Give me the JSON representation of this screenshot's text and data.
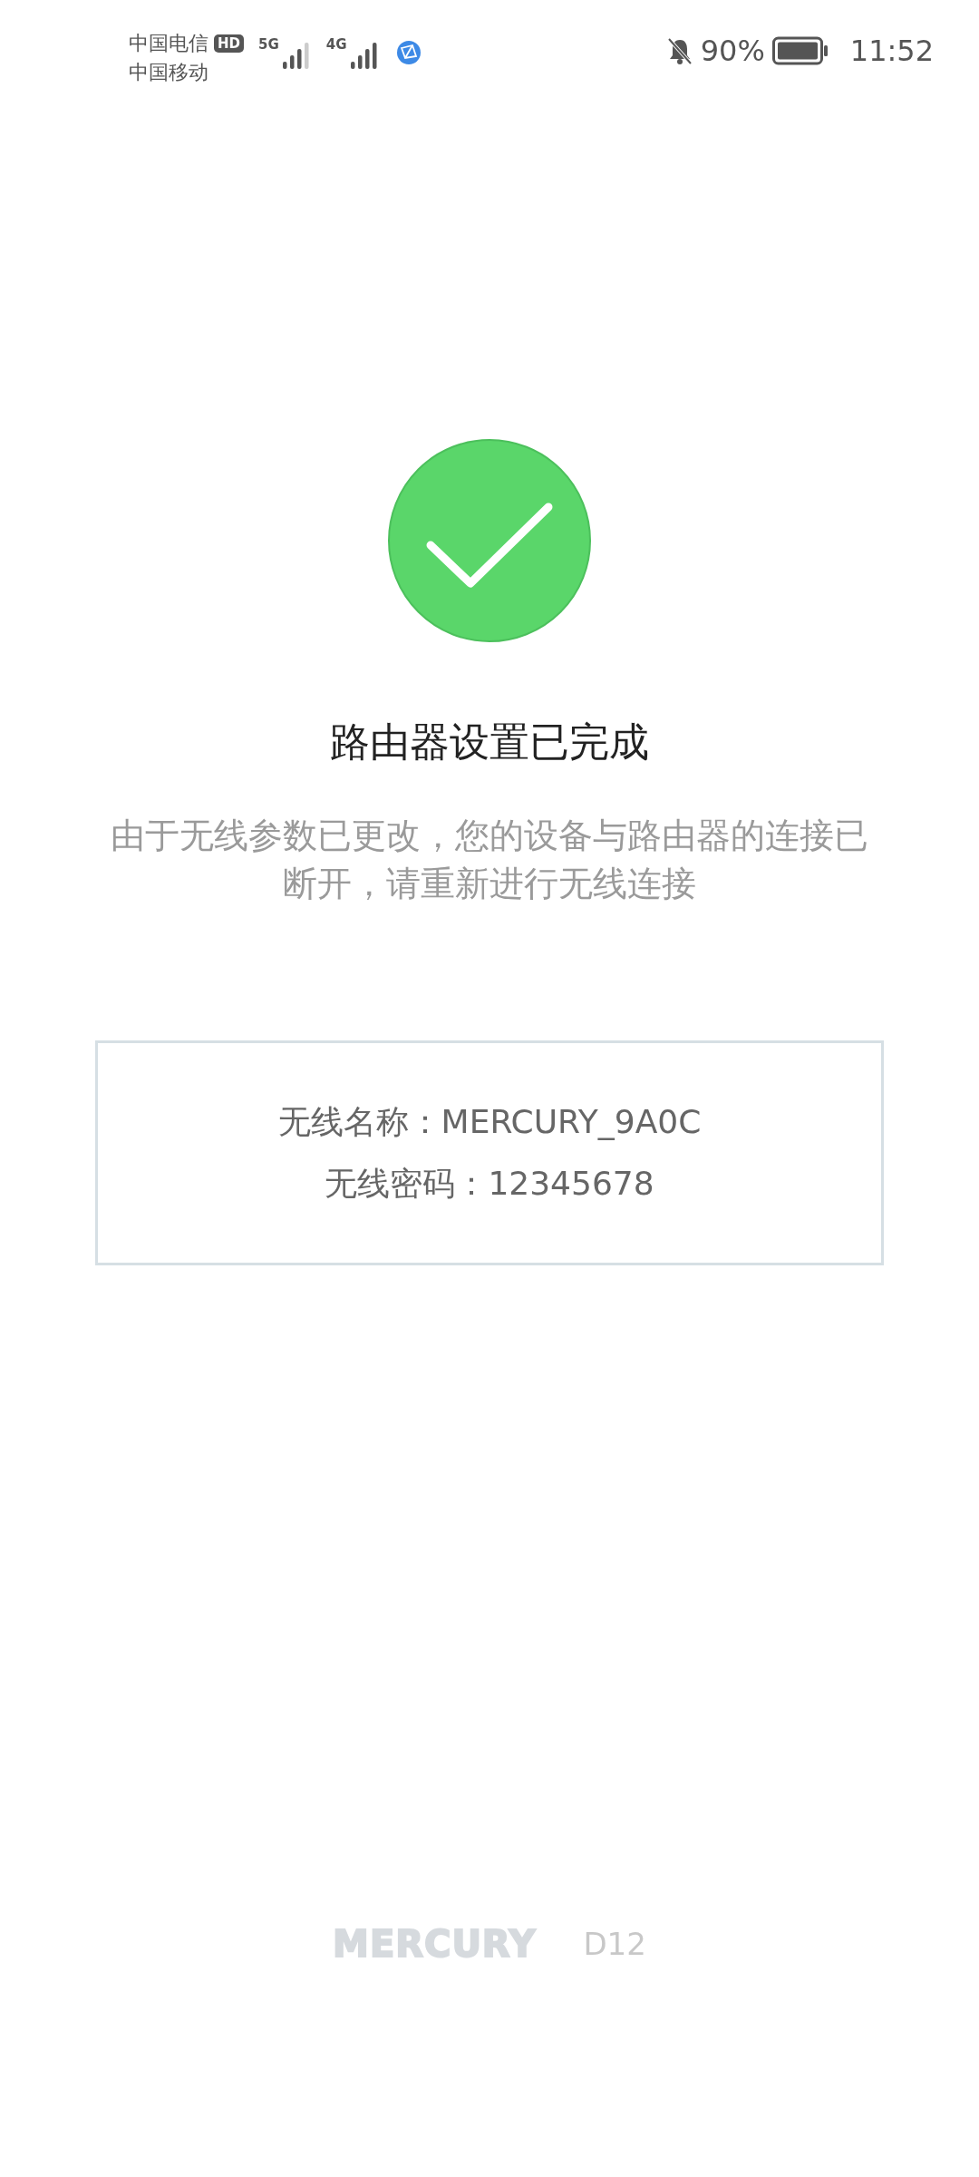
{
  "status_bar": {
    "carriers": [
      "中国电信",
      "中国移动"
    ],
    "hd_badge": "HD",
    "networks": [
      "5G",
      "4G"
    ],
    "battery_percent": "90%",
    "time": "11:52"
  },
  "result": {
    "title": "路由器设置已完成",
    "message": "由于无线参数已更改，您的设备与路由器的连接已断开，请重新进行无线连接"
  },
  "wifi_info": [
    {
      "label": "无线名称：",
      "value": "MERCURY_9A0C"
    },
    {
      "label": "无线密码：",
      "value": "12345678"
    }
  ],
  "footer": {
    "brand": "MERCURY",
    "model": "D12"
  }
}
